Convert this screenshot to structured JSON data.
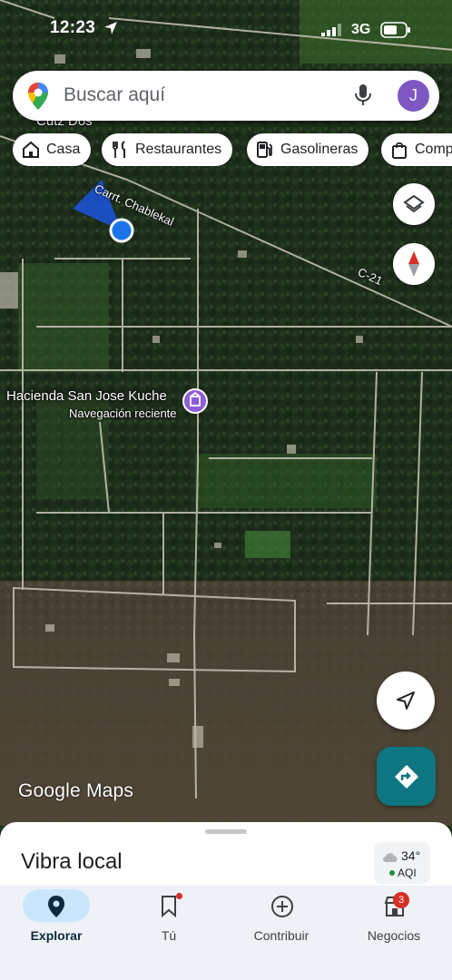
{
  "status_bar": {
    "time": "12:23",
    "network": "3G"
  },
  "search": {
    "placeholder": "Buscar aquí",
    "avatar_letter": "J"
  },
  "chips": [
    {
      "label": "Casa",
      "icon": "home-icon"
    },
    {
      "label": "Restaurantes",
      "icon": "fork-knife-icon"
    },
    {
      "label": "Gasolineras",
      "icon": "gas-station-icon"
    },
    {
      "label": "Comp",
      "icon": "shopping-bag-icon"
    }
  ],
  "map": {
    "labels": {
      "town": "Cutz Dos",
      "road_main": "Carrt. Chablekal",
      "road_c21": "C-21"
    },
    "place": {
      "title": "Hacienda San Jose Kuche",
      "subtitle": "Navegación reciente",
      "color": "#8e5ed6"
    },
    "watermark": "Google Maps",
    "location_color": "#1a73e8"
  },
  "sheet": {
    "title": "Vibra local",
    "temperature": "34°",
    "aqi_label": "AQI"
  },
  "nav": {
    "items": [
      {
        "label": "Explorar",
        "icon": "explore-pin-icon",
        "active": true
      },
      {
        "label": "Tú",
        "icon": "bookmark-icon",
        "dot": true
      },
      {
        "label": "Contribuir",
        "icon": "add-circle-icon"
      },
      {
        "label": "Negocios",
        "icon": "store-icon",
        "badge": "3"
      }
    ]
  },
  "colors": {
    "accent_teal": "#0e7681",
    "nav_active": "#c9e6fb",
    "badge_red": "#d93025"
  }
}
